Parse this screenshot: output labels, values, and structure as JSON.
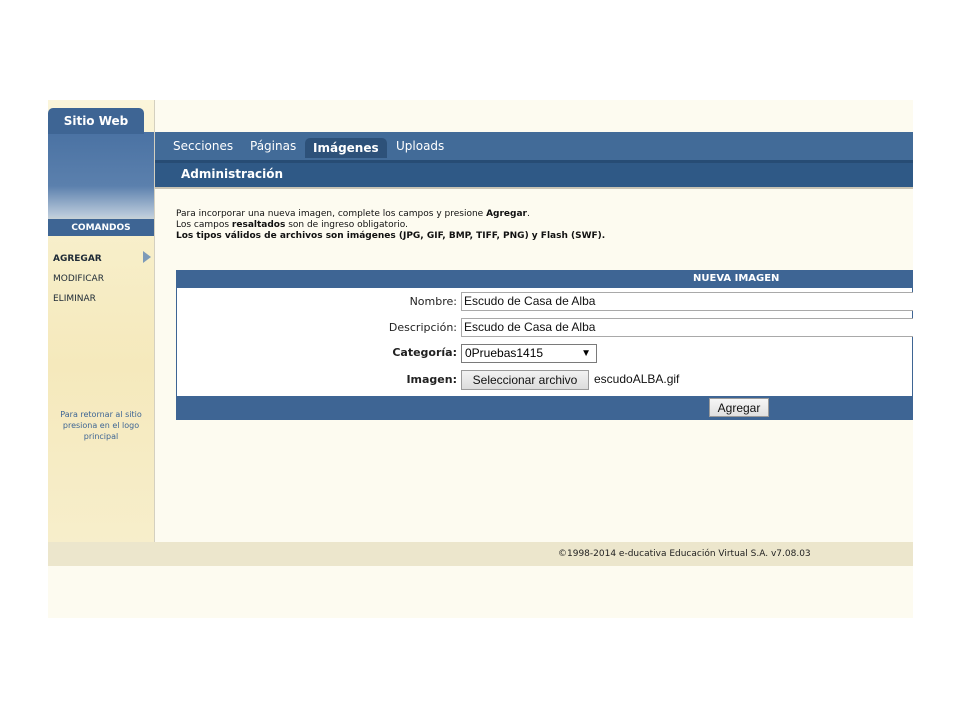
{
  "sidebar": {
    "site_tab": "Sitio Web",
    "commands_header": "COMANDOS",
    "items": [
      {
        "label": "AGREGAR",
        "active": true
      },
      {
        "label": "MODIFICAR",
        "active": false
      },
      {
        "label": "ELIMINAR",
        "active": false
      }
    ],
    "note": "Para retornar al sitio presiona en el logo principal"
  },
  "nav": {
    "tabs": [
      {
        "label": "Secciones",
        "active": false
      },
      {
        "label": "Páginas",
        "active": false
      },
      {
        "label": "Imágenes",
        "active": true
      },
      {
        "label": "Uploads",
        "active": false
      }
    ]
  },
  "section_title": "Administración",
  "instructions": {
    "line1_prefix": "Para incorporar una nueva imagen, complete los campos y presione ",
    "line1_bold": "Agregar",
    "line1_suffix": ".",
    "line2_prefix": "Los campos ",
    "line2_bold": "resaltados",
    "line2_suffix": " son de ingreso obligatorio.",
    "line3": "Los tipos válidos de archivos son imágenes (JPG, GIF, BMP, TIFF, PNG) y Flash (SWF)."
  },
  "form": {
    "header": "NUEVA IMAGEN",
    "nombre_label": "Nombre:",
    "nombre_value": "Escudo de Casa de Alba",
    "descripcion_label": "Descripción:",
    "descripcion_value": "Escudo de Casa de Alba",
    "categoria_label": "Categoría:",
    "categoria_value": "0Pruebas1415",
    "imagen_label": "Imagen:",
    "file_button": "Seleccionar archivo",
    "file_name": "escudoALBA.gif",
    "submit": "Agregar"
  },
  "footer": "©1998-2014 e-ducativa Educación Virtual S.A. v7.08.03",
  "colors": {
    "nav_blue": "#426b98",
    "active_tab": "#2d5179",
    "form_header": "#3e6594",
    "sidebar_cream": "#f7eec8"
  }
}
